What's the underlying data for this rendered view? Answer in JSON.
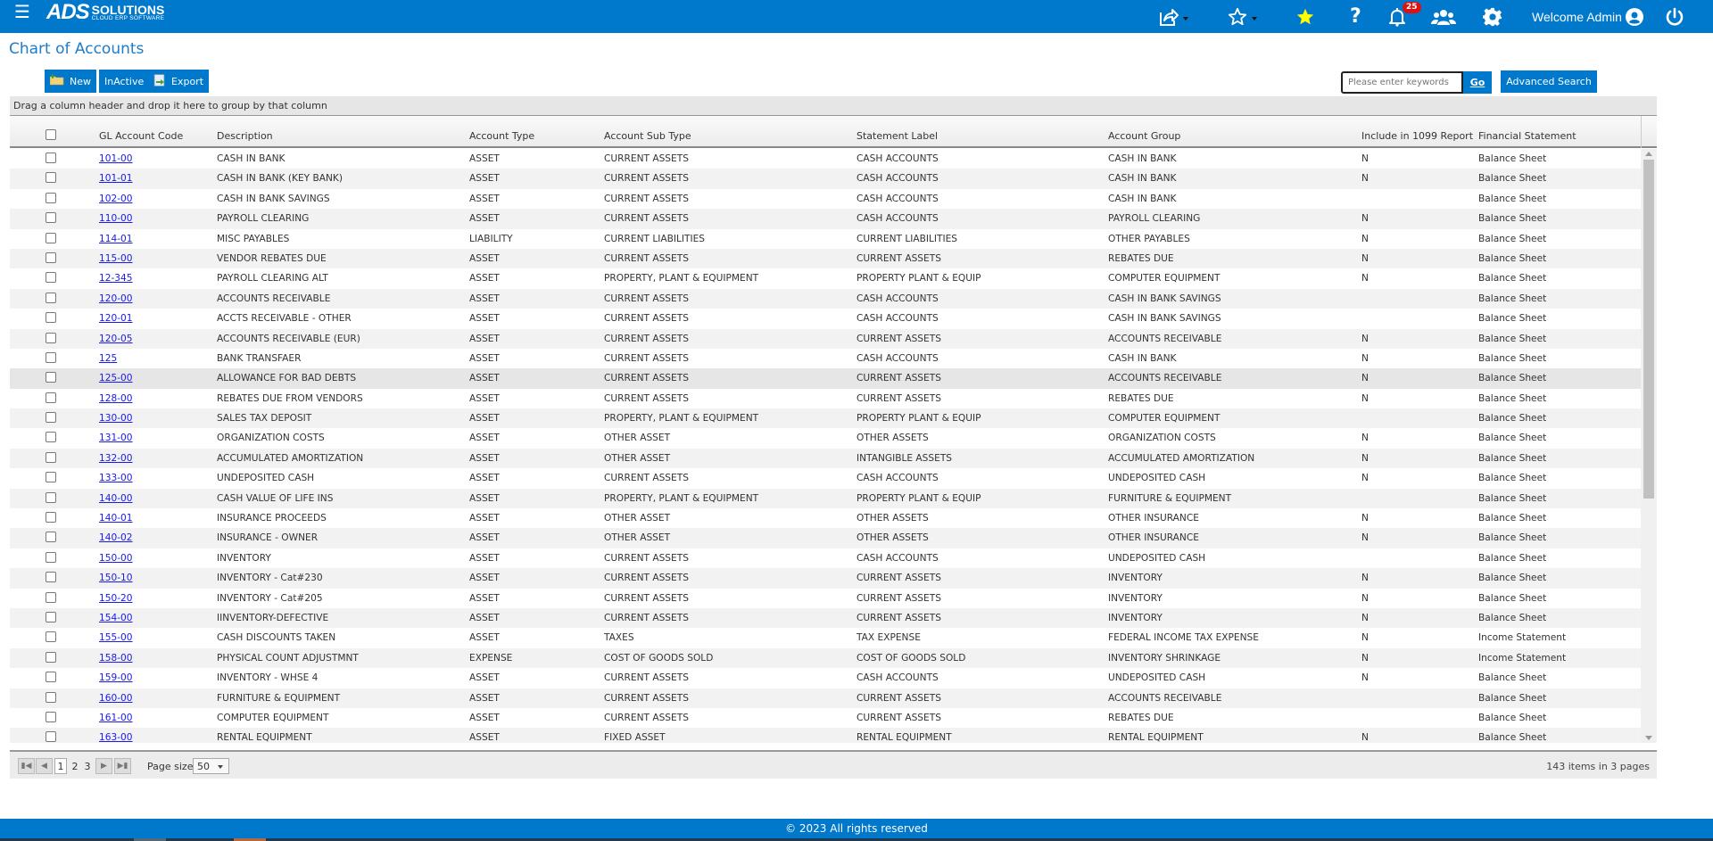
{
  "header": {
    "logo_main": "ADS",
    "logo_brand": "SOLUTIONS",
    "logo_tagline": "CLOUD ERP SOFTWARE",
    "notification_count": "25",
    "welcome_text": "Welcome Admin",
    "icons": [
      "menu-icon",
      "share-icon",
      "favorites-outline-icon",
      "favorite-star-icon",
      "help-icon",
      "bell-icon",
      "users-icon",
      "gear-icon",
      "user-avatar-icon",
      "power-icon"
    ],
    "colors": {
      "primary": "#0078cc",
      "star": "#ffff00",
      "badge": "#dd1111"
    }
  },
  "page": {
    "title": "Chart of Accounts"
  },
  "toolbar": {
    "new_label": "New",
    "inactive_label": "InActive",
    "export_label": "Export",
    "search_placeholder": "Please enter keywords",
    "search_value": "",
    "go_label": "Go",
    "advanced_search_label": "Advanced Search"
  },
  "grid": {
    "group_hint": "Drag a column header and drop it here to group by that column",
    "columns": [
      "GL Account Code",
      "Description",
      "Account Type",
      "Account Sub Type",
      "Statement Label",
      "Account Group",
      "Include in 1099 Report",
      "Financial Statement"
    ],
    "rows": [
      {
        "code": "101-00",
        "desc": "CASH IN BANK",
        "type": "ASSET",
        "subtype": "CURRENT ASSETS",
        "label": "CASH ACCOUNTS",
        "group": "CASH IN BANK",
        "r1099": "N",
        "fs": "Balance Sheet"
      },
      {
        "code": "101-01",
        "desc": "CASH IN BANK (KEY BANK)",
        "type": "ASSET",
        "subtype": "CURRENT ASSETS",
        "label": "CASH ACCOUNTS",
        "group": "CASH IN BANK",
        "r1099": "N",
        "fs": "Balance Sheet"
      },
      {
        "code": "102-00",
        "desc": "CASH IN BANK SAVINGS",
        "type": "ASSET",
        "subtype": "CURRENT ASSETS",
        "label": "CASH ACCOUNTS",
        "group": "CASH IN BANK",
        "r1099": "",
        "fs": "Balance Sheet"
      },
      {
        "code": "110-00",
        "desc": "PAYROLL CLEARING",
        "type": "ASSET",
        "subtype": "CURRENT ASSETS",
        "label": "CASH ACCOUNTS",
        "group": "PAYROLL CLEARING",
        "r1099": "N",
        "fs": "Balance Sheet"
      },
      {
        "code": "114-01",
        "desc": "MISC PAYABLES",
        "type": "LIABILITY",
        "subtype": "CURRENT LIABILITIES",
        "label": "CURRENT LIABILITIES",
        "group": "OTHER PAYABLES",
        "r1099": "N",
        "fs": "Balance Sheet"
      },
      {
        "code": "115-00",
        "desc": "VENDOR REBATES DUE",
        "type": "ASSET",
        "subtype": "CURRENT ASSETS",
        "label": "CURRENT ASSETS",
        "group": "REBATES DUE",
        "r1099": "N",
        "fs": "Balance Sheet"
      },
      {
        "code": "12-345",
        "desc": "PAYROLL CLEARING ALT",
        "type": "ASSET",
        "subtype": "PROPERTY, PLANT & EQUIPMENT",
        "label": "PROPERTY PLANT & EQUIP",
        "group": "COMPUTER EQUIPMENT",
        "r1099": "N",
        "fs": "Balance Sheet"
      },
      {
        "code": "120-00",
        "desc": "ACCOUNTS RECEIVABLE",
        "type": "ASSET",
        "subtype": "CURRENT ASSETS",
        "label": "CASH ACCOUNTS",
        "group": "CASH IN BANK SAVINGS",
        "r1099": "",
        "fs": "Balance Sheet"
      },
      {
        "code": "120-01",
        "desc": "ACCTS RECEIVABLE - OTHER",
        "type": "ASSET",
        "subtype": "CURRENT ASSETS",
        "label": "CASH ACCOUNTS",
        "group": "CASH IN BANK SAVINGS",
        "r1099": "",
        "fs": "Balance Sheet"
      },
      {
        "code": "120-05",
        "desc": "ACCOUNTS RECEIVABLE (EUR)",
        "type": "ASSET",
        "subtype": "CURRENT ASSETS",
        "label": "CURRENT ASSETS",
        "group": "ACCOUNTS RECEIVABLE",
        "r1099": "N",
        "fs": "Balance Sheet"
      },
      {
        "code": "125",
        "desc": "BANK TRANSFAER",
        "type": "ASSET",
        "subtype": "CURRENT ASSETS",
        "label": "CASH ACCOUNTS",
        "group": "CASH IN BANK",
        "r1099": "N",
        "fs": "Balance Sheet"
      },
      {
        "code": "125-00",
        "desc": "ALLOWANCE FOR BAD DEBTS",
        "type": "ASSET",
        "subtype": "CURRENT ASSETS",
        "label": "CURRENT ASSETS",
        "group": "ACCOUNTS RECEIVABLE",
        "r1099": "N",
        "fs": "Balance Sheet"
      },
      {
        "code": "128-00",
        "desc": "REBATES DUE FROM VENDORS",
        "type": "ASSET",
        "subtype": "CURRENT ASSETS",
        "label": "CURRENT ASSETS",
        "group": "REBATES DUE",
        "r1099": "N",
        "fs": "Balance Sheet"
      },
      {
        "code": "130-00",
        "desc": "SALES TAX DEPOSIT",
        "type": "ASSET",
        "subtype": "PROPERTY, PLANT & EQUIPMENT",
        "label": "PROPERTY PLANT & EQUIP",
        "group": "COMPUTER EQUIPMENT",
        "r1099": "",
        "fs": "Balance Sheet"
      },
      {
        "code": "131-00",
        "desc": "ORGANIZATION COSTS",
        "type": "ASSET",
        "subtype": "OTHER ASSET",
        "label": "OTHER ASSETS",
        "group": "ORGANIZATION COSTS",
        "r1099": "N",
        "fs": "Balance Sheet"
      },
      {
        "code": "132-00",
        "desc": "ACCUMULATED AMORTIZATION",
        "type": "ASSET",
        "subtype": "OTHER ASSET",
        "label": "INTANGIBLE ASSETS",
        "group": "ACCUMULATED AMORTIZATION",
        "r1099": "N",
        "fs": "Balance Sheet"
      },
      {
        "code": "133-00",
        "desc": "UNDEPOSITED CASH",
        "type": "ASSET",
        "subtype": "CURRENT ASSETS",
        "label": "CASH ACCOUNTS",
        "group": "UNDEPOSITED CASH",
        "r1099": "N",
        "fs": "Balance Sheet"
      },
      {
        "code": "140-00",
        "desc": "CASH VALUE OF LIFE INS",
        "type": "ASSET",
        "subtype": "PROPERTY, PLANT & EQUIPMENT",
        "label": "PROPERTY PLANT & EQUIP",
        "group": "FURNITURE & EQUIPMENT",
        "r1099": "",
        "fs": "Balance Sheet"
      },
      {
        "code": "140-01",
        "desc": "INSURANCE PROCEEDS",
        "type": "ASSET",
        "subtype": "OTHER ASSET",
        "label": "OTHER ASSETS",
        "group": "OTHER INSURANCE",
        "r1099": "N",
        "fs": "Balance Sheet"
      },
      {
        "code": "140-02",
        "desc": "INSURANCE - OWNER",
        "type": "ASSET",
        "subtype": "OTHER ASSET",
        "label": "OTHER ASSETS",
        "group": "OTHER INSURANCE",
        "r1099": "N",
        "fs": "Balance Sheet"
      },
      {
        "code": "150-00",
        "desc": "INVENTORY",
        "type": "ASSET",
        "subtype": "CURRENT ASSETS",
        "label": "CASH ACCOUNTS",
        "group": "UNDEPOSITED CASH",
        "r1099": "",
        "fs": "Balance Sheet"
      },
      {
        "code": "150-10",
        "desc": "INVENTORY - Cat#230",
        "type": "ASSET",
        "subtype": "CURRENT ASSETS",
        "label": "CURRENT ASSETS",
        "group": "INVENTORY",
        "r1099": "N",
        "fs": "Balance Sheet"
      },
      {
        "code": "150-20",
        "desc": "INVENTORY - Cat#205",
        "type": "ASSET",
        "subtype": "CURRENT ASSETS",
        "label": "CURRENT ASSETS",
        "group": "INVENTORY",
        "r1099": "N",
        "fs": "Balance Sheet"
      },
      {
        "code": "154-00",
        "desc": "IINVENTORY-DEFECTIVE",
        "type": "ASSET",
        "subtype": "CURRENT ASSETS",
        "label": "CURRENT ASSETS",
        "group": "INVENTORY",
        "r1099": "N",
        "fs": "Balance Sheet"
      },
      {
        "code": "155-00",
        "desc": "CASH DISCOUNTS TAKEN",
        "type": "ASSET",
        "subtype": "TAXES",
        "label": "TAX EXPENSE",
        "group": "FEDERAL INCOME TAX EXPENSE",
        "r1099": "N",
        "fs": "Income Statement"
      },
      {
        "code": "158-00",
        "desc": "PHYSICAL COUNT ADJUSTMNT",
        "type": "EXPENSE",
        "subtype": "COST OF GOODS SOLD",
        "label": "COST OF GOODS SOLD",
        "group": "INVENTORY SHRINKAGE",
        "r1099": "N",
        "fs": "Income Statement"
      },
      {
        "code": "159-00",
        "desc": "INVENTORY - WHSE 4",
        "type": "ASSET",
        "subtype": "CURRENT ASSETS",
        "label": "CASH ACCOUNTS",
        "group": "UNDEPOSITED CASH",
        "r1099": "N",
        "fs": "Balance Sheet"
      },
      {
        "code": "160-00",
        "desc": "FURNITURE & EQUIPMENT",
        "type": "ASSET",
        "subtype": "CURRENT ASSETS",
        "label": "CURRENT ASSETS",
        "group": "ACCOUNTS RECEIVABLE",
        "r1099": "",
        "fs": "Balance Sheet"
      },
      {
        "code": "161-00",
        "desc": "COMPUTER EQUIPMENT",
        "type": "ASSET",
        "subtype": "CURRENT ASSETS",
        "label": "CURRENT ASSETS",
        "group": "REBATES DUE",
        "r1099": "",
        "fs": "Balance Sheet"
      },
      {
        "code": "163-00",
        "desc": "RENTAL EQUIPMENT",
        "type": "ASSET",
        "subtype": "FIXED ASSET",
        "label": "RENTAL EQUIPMENT",
        "group": "RENTAL EQUIPMENT",
        "r1099": "N",
        "fs": "Balance Sheet"
      }
    ],
    "hover_row_index": 11
  },
  "pager": {
    "pages": [
      "1",
      "2",
      "3"
    ],
    "current_page": "1",
    "page_size_label": "Page size:",
    "page_size": "50",
    "info": "143 items in 3 pages"
  },
  "footer": {
    "copyright": "© 2023 All rights reserved"
  }
}
